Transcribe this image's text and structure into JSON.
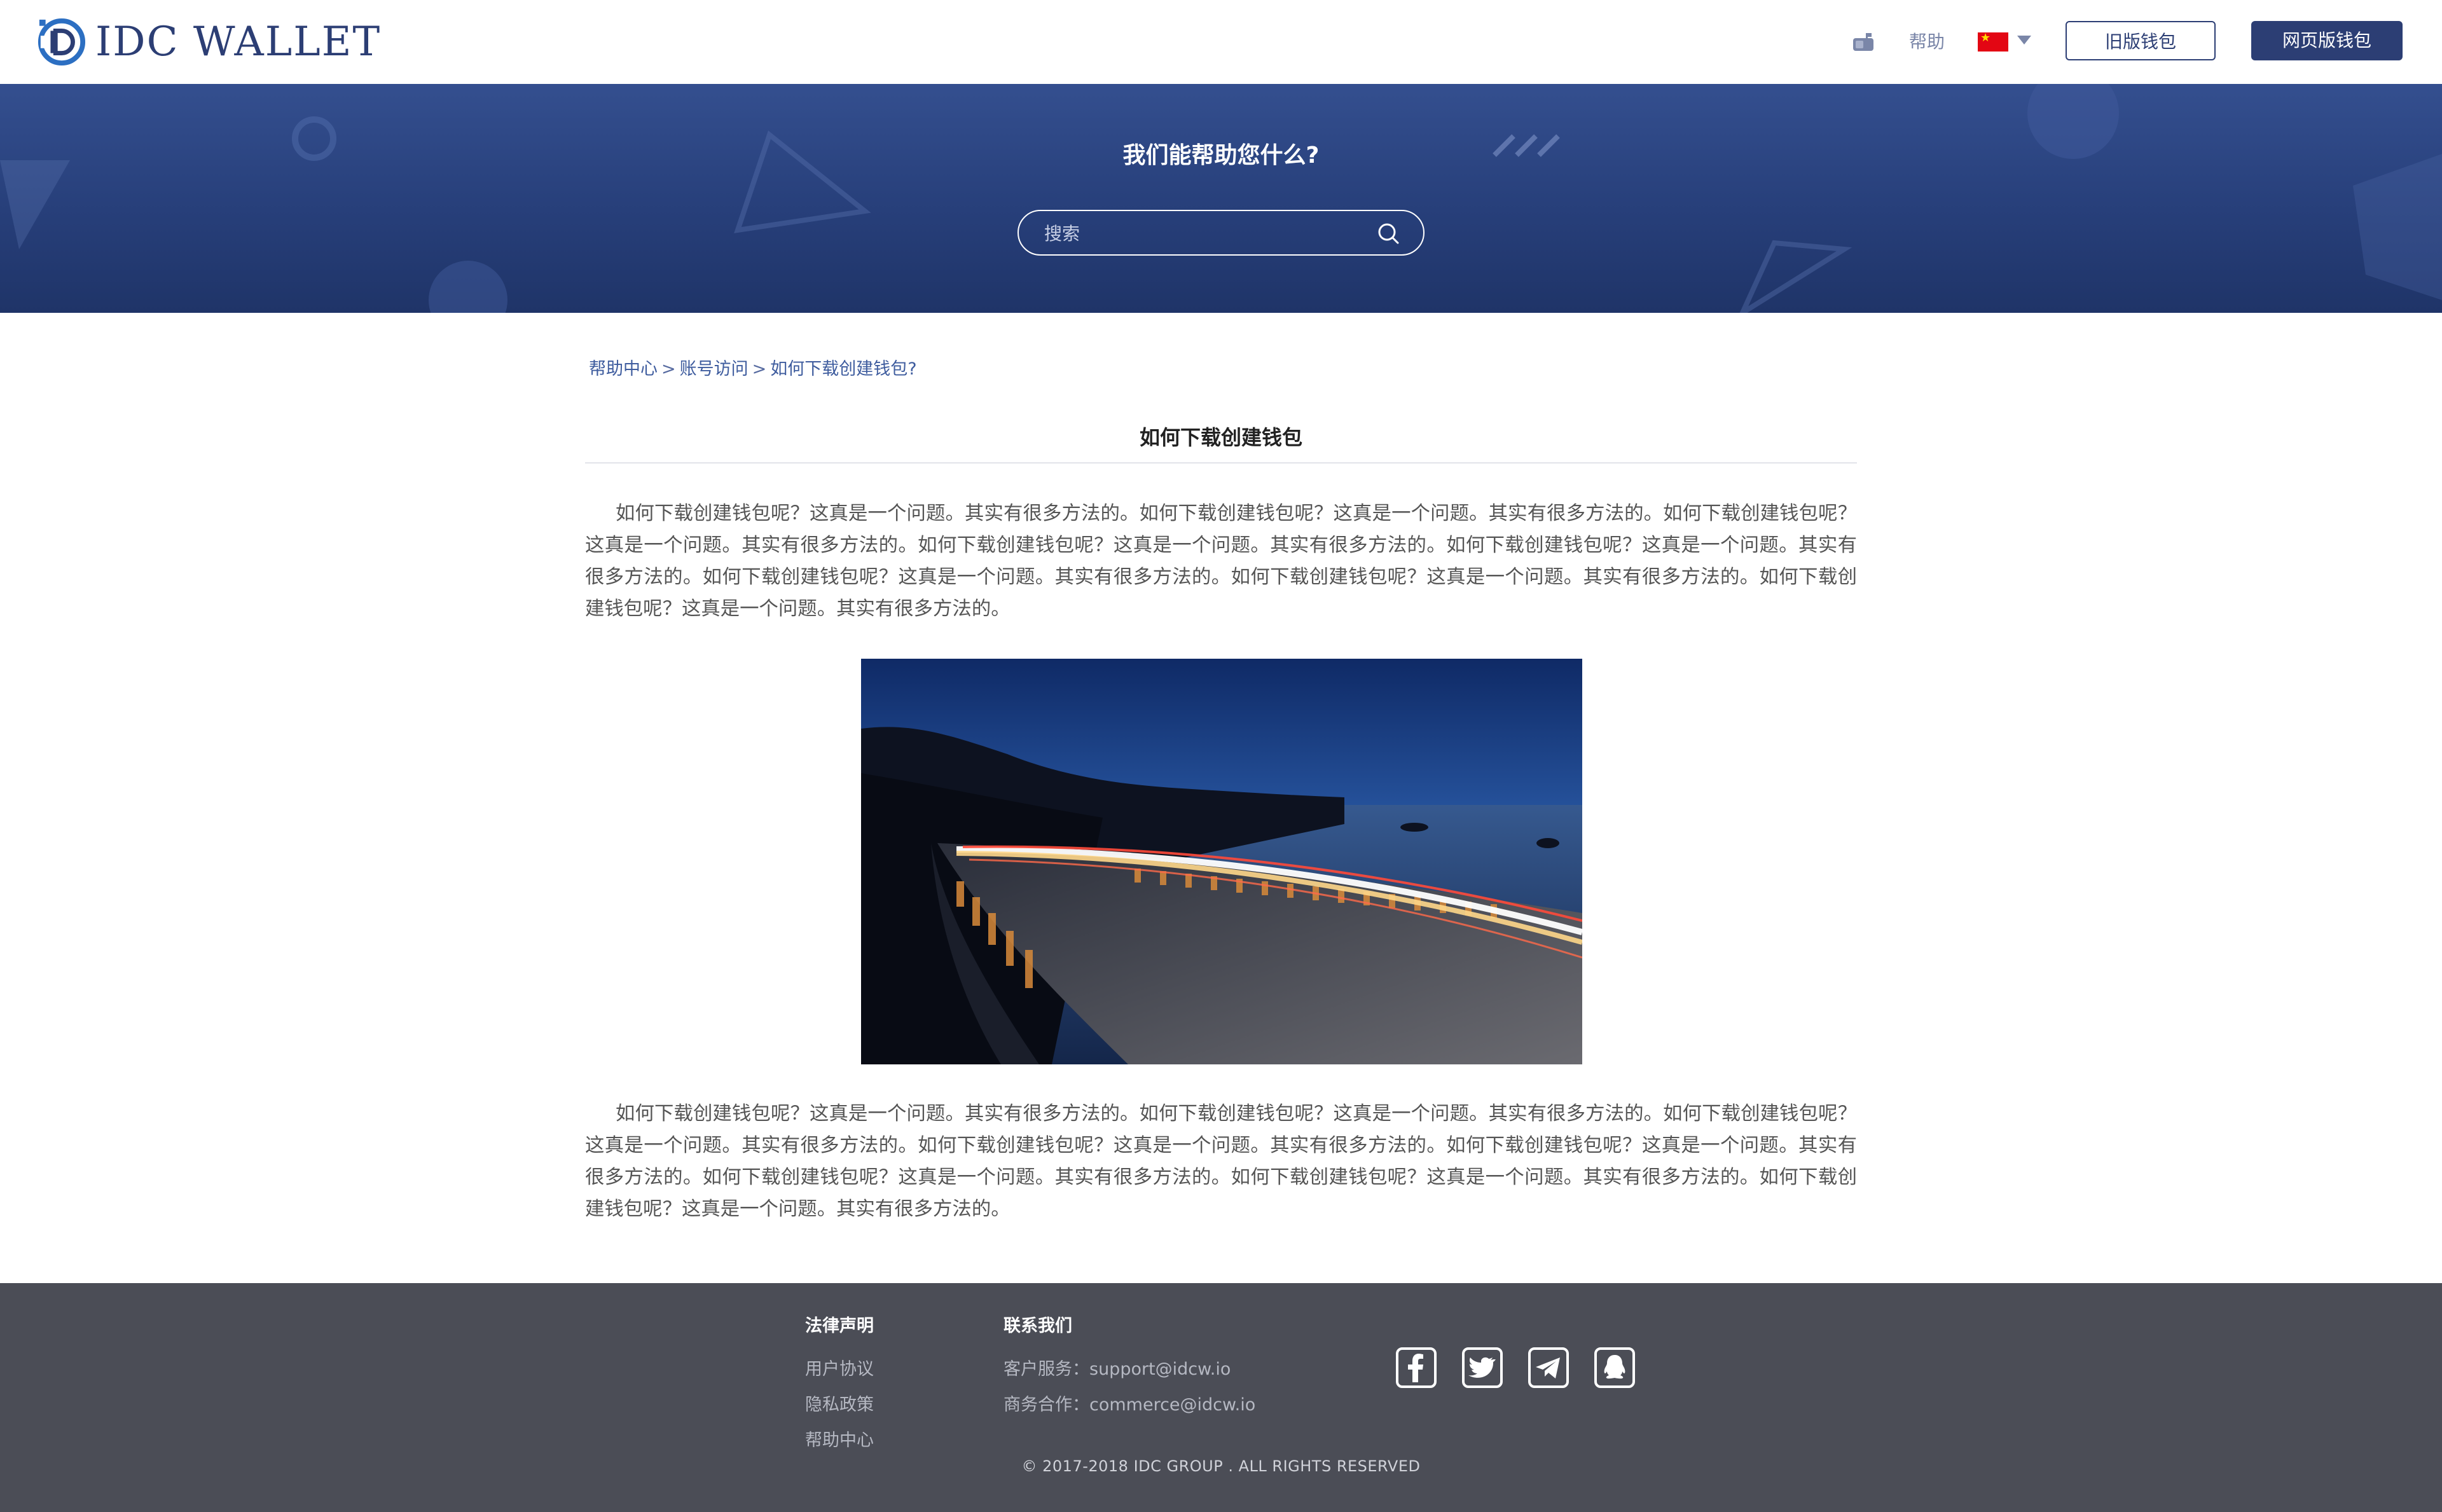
{
  "header": {
    "logo_text": "IDC WALLET",
    "help_label": "帮助",
    "language_flag": "cn-flag-icon",
    "old_wallet_label": "旧版钱包",
    "web_wallet_label": "网页版钱包",
    "icon_names": [
      "mailbox-icon",
      "cn-flag-icon",
      "caret-down-icon"
    ]
  },
  "banner": {
    "title": "我们能帮助您什么?",
    "search_placeholder": "搜索",
    "search_icon": "search-icon"
  },
  "breadcrumb": {
    "items": [
      "帮助中心",
      "账号访问",
      "如何下载创建钱包?"
    ],
    "separator": ">"
  },
  "article": {
    "title": "如何下载创建钱包",
    "paragraph_1": "如何下载创建钱包呢？这真是一个问题。其实有很多方法的。如何下载创建钱包呢？这真是一个问题。其实有很多方法的。如何下载创建钱包呢？这真是一个问题。其实有很多方法的。如何下载创建钱包呢？这真是一个问题。其实有很多方法的。如何下载创建钱包呢？这真是一个问题。其实有很多方法的。如何下载创建钱包呢？这真是一个问题。其实有很多方法的。如何下载创建钱包呢？这真是一个问题。其实有很多方法的。如何下载创建钱包呢？这真是一个问题。其实有很多方法的。",
    "image": "night-coastal-bridge-light-trails-photo",
    "paragraph_2": "如何下载创建钱包呢？这真是一个问题。其实有很多方法的。如何下载创建钱包呢？这真是一个问题。其实有很多方法的。如何下载创建钱包呢？这真是一个问题。其实有很多方法的。如何下载创建钱包呢？这真是一个问题。其实有很多方法的。如何下载创建钱包呢？这真是一个问题。其实有很多方法的。如何下载创建钱包呢？这真是一个问题。其实有很多方法的。如何下载创建钱包呢？这真是一个问题。其实有很多方法的。如何下载创建钱包呢？这真是一个问题。其实有很多方法的。"
  },
  "footer": {
    "legal_heading": "法律声明",
    "legal_links": [
      "用户协议",
      "隐私政策",
      "帮助中心"
    ],
    "contact_heading": "联系我们",
    "contact_lines": [
      "客户服务：support@idcw.io",
      "商务合作：commerce@idcw.io"
    ],
    "social_icons": [
      "facebook-icon",
      "twitter-icon",
      "telegram-icon",
      "qq-icon"
    ],
    "copyright": "© 2017-2018 IDC GROUP . ALL RIGHTS RESERVED"
  },
  "colors": {
    "brand_navy": "#2c3e74",
    "banner_top": "#344f8f",
    "banner_bottom": "#1f3468",
    "footer_bg": "#4b4d56",
    "breadcrumb_link": "#3e5c9e"
  }
}
